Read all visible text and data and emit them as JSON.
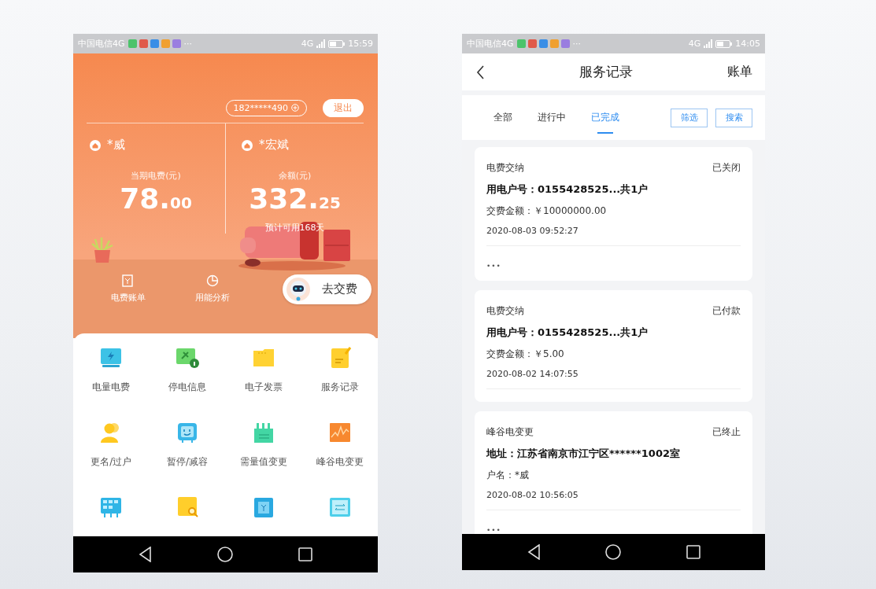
{
  "home_screen": {
    "status_bar": {
      "carrier": "中国电信4G",
      "overflow": "···",
      "network": "4G",
      "time": "15:59"
    },
    "account": {
      "number": "182*****490",
      "logout": "退出"
    },
    "accounts": [
      {
        "name": "*威",
        "label": "当期电费(元)",
        "amount": "78.",
        "fraction": "00"
      },
      {
        "name": "*宏斌",
        "label": "余额(元)",
        "amount": "332.",
        "fraction": "25",
        "note": "预计可用168天"
      }
    ],
    "quick_links": [
      {
        "kind": "bill",
        "label": "电费账单"
      },
      {
        "kind": "analysis",
        "label": "用能分析"
      }
    ],
    "pay_button": "去交费",
    "services": [
      {
        "kind": "usage",
        "label": "电量电费"
      },
      {
        "kind": "outage",
        "label": "停电信息"
      },
      {
        "kind": "invoice",
        "label": "电子发票"
      },
      {
        "kind": "record",
        "label": "服务记录"
      },
      {
        "kind": "rename",
        "label": "更名/过户"
      },
      {
        "kind": "suspend",
        "label": "暂停/减容"
      },
      {
        "kind": "demand",
        "label": "需量值变更"
      },
      {
        "kind": "peak",
        "label": "峰谷电变更"
      },
      {
        "kind": "meter"
      },
      {
        "kind": "query"
      },
      {
        "kind": "bill"
      },
      {
        "kind": "tariff"
      }
    ]
  },
  "records_screen": {
    "status_bar": {
      "carrier": "中国电信4G",
      "overflow": "···",
      "network": "4G",
      "time": "14:05"
    },
    "header": {
      "title": "服务记录",
      "action": "账单"
    },
    "tabs": [
      {
        "label": "全部",
        "selected": false
      },
      {
        "label": "进行中",
        "selected": false
      },
      {
        "label": "已完成",
        "selected": true
      }
    ],
    "tool_buttons": [
      "筛选",
      "搜索"
    ],
    "records": [
      {
        "type": "电费交纳",
        "status": "已关闭",
        "lines": [
          {
            "text": "用电户号：0155428525...共1户",
            "bold": true
          },
          {
            "text": "交费金额：￥10000000.00",
            "bold": false
          }
        ],
        "time": "2020-08-03 09:52:27",
        "more": "•••"
      },
      {
        "type": "电费交纳",
        "status": "已付款",
        "lines": [
          {
            "text": "用电户号：0155428525...共1户",
            "bold": true
          },
          {
            "text": "交费金额：￥5.00",
            "bold": false
          }
        ],
        "time": "2020-08-02 14:07:55"
      },
      {
        "type": "峰谷电变更",
        "status": "已终止",
        "lines": [
          {
            "text": "地址：江苏省南京市江宁区******1002室",
            "bold": true
          },
          {
            "text": "户名：*威",
            "bold": false
          }
        ],
        "time": "2020-08-02 10:56:05",
        "more": "•••"
      }
    ]
  }
}
